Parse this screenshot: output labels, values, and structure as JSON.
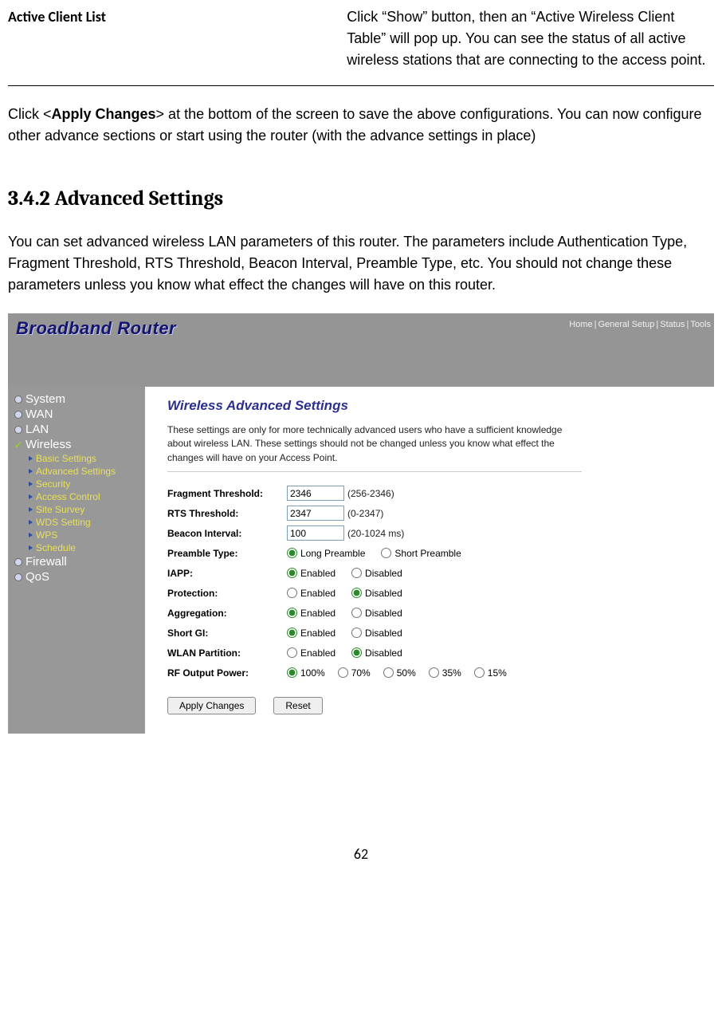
{
  "top": {
    "label": "Active Client List",
    "desc": "Click “Show” button, then an “Active Wireless Client Table” will pop up. You can see the status of all active wireless stations that are connecting to the access point."
  },
  "apply": {
    "pre": "Click <",
    "bold": "Apply Changes",
    "post": "> at the bottom of the screen to save the above configurations. You can now configure other advance sections or start using the router (with the advance settings in place)"
  },
  "heading": "3.4.2 Advanced Settings",
  "intro": "You can set advanced wireless LAN parameters of this router. The parameters include Authentication Type, Fragment Threshold, RTS Threshold, Beacon Interval, Preamble Type, etc. You should not change these parameters unless you know what effect the changes will have on this router.",
  "router": {
    "brand": "Broadband Router",
    "links": [
      "Home",
      "General Setup",
      "Status",
      "Tools"
    ],
    "sidebar_top": [
      "System",
      "WAN",
      "LAN"
    ],
    "sidebar_wireless": "Wireless",
    "sidebar_sub": [
      "Basic Settings",
      "Advanced Settings",
      "Security",
      "Access Control",
      "Site Survey",
      "WDS Setting",
      "WPS",
      "Schedule"
    ],
    "sidebar_bottom": [
      "Firewall",
      "QoS"
    ],
    "title": "Wireless Advanced Settings",
    "desc": "These settings are only for more technically advanced users who have a sufficient knowledge about wireless LAN. These settings should not be changed unless you know what effect the changes will have on your Access Point.",
    "rows": {
      "frag": {
        "label": "Fragment Threshold:",
        "value": "2346",
        "hint": "(256-2346)"
      },
      "rts": {
        "label": "RTS Threshold:",
        "value": "2347",
        "hint": "(0-2347)"
      },
      "beacon": {
        "label": "Beacon Interval:",
        "value": "100",
        "hint": "(20-1024 ms)"
      },
      "preamble": {
        "label": "Preamble Type:",
        "opt1": "Long Preamble",
        "opt2": "Short Preamble"
      },
      "iapp": {
        "label": "IAPP:",
        "opt1": "Enabled",
        "opt2": "Disabled"
      },
      "protection": {
        "label": "Protection:",
        "opt1": "Enabled",
        "opt2": "Disabled"
      },
      "aggregation": {
        "label": "Aggregation:",
        "opt1": "Enabled",
        "opt2": "Disabled"
      },
      "shortgi": {
        "label": "Short GI:",
        "opt1": "Enabled",
        "opt2": "Disabled"
      },
      "wlanpart": {
        "label": "WLAN Partition:",
        "opt1": "Enabled",
        "opt2": "Disabled"
      },
      "rf": {
        "label": "RF Output Power:",
        "opts": [
          "100%",
          "70%",
          "50%",
          "35%",
          "15%"
        ]
      }
    },
    "buttons": {
      "apply": "Apply Changes",
      "reset": "Reset"
    }
  },
  "page_number": "62"
}
